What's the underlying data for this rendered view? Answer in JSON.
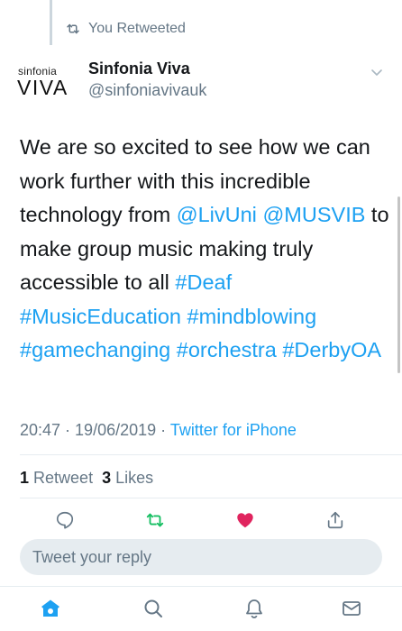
{
  "retweet_context": {
    "icon": "retweet-icon",
    "label": "You Retweeted"
  },
  "account": {
    "logo_top": "sinfonia",
    "logo_bottom": "VIVA",
    "display_name": "Sinfonia Viva",
    "handle": "@sinfoniavivauk"
  },
  "tweet": {
    "t1": "We are so excited to see how we can work further with this incredible technology from ",
    "mention1": "@LivUni",
    "t2": " ",
    "mention2": "@MUSVIB",
    "t3": " to make group music making truly accessible to all ",
    "tag1": "#Deaf",
    "tag2": "#MusicEducation",
    "tag3": "#mindblowing",
    "tag4": "#gamechanging",
    "tag5": "#orchestra",
    "tag6": "#DerbyOA"
  },
  "meta": {
    "time": "20:47",
    "sep1": " · ",
    "date": "19/06/2019",
    "sep2": " · ",
    "source": "Twitter for iPhone"
  },
  "stats": {
    "retweets_count": "1",
    "retweets_label": "Retweet",
    "likes_count": "3",
    "likes_label": "Likes"
  },
  "actions": {
    "reply_icon": "comment-icon",
    "retweet_icon": "retweet-icon",
    "like_icon": "heart-icon",
    "share_icon": "share-icon",
    "retweet_active_color": "#17bf63",
    "like_active_color": "#e0245e"
  },
  "reply": {
    "placeholder": "Tweet your reply"
  },
  "tabbar": {
    "home_icon": "home-icon",
    "search_icon": "search-icon",
    "notifications_icon": "bell-icon",
    "messages_icon": "mail-icon",
    "active_color": "#1da1f2"
  }
}
